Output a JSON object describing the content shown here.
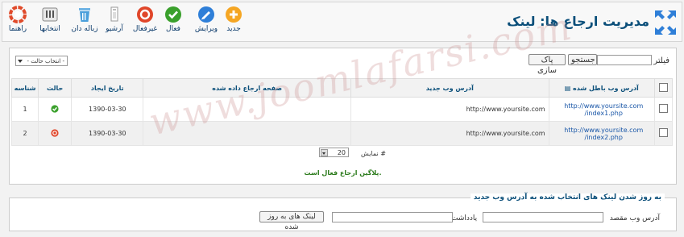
{
  "toolbar": {
    "title": "مدیریت ارجاع ها: لینک",
    "buttons": [
      {
        "label": "جدید",
        "icon": "plus-icon"
      },
      {
        "label": "ویرایش",
        "icon": "edit-icon"
      },
      {
        "label": "فعال",
        "icon": "check-icon"
      },
      {
        "label": "غیرفعال",
        "icon": "unpublish-icon"
      },
      {
        "label": "آرشیو",
        "icon": "archive-icon"
      },
      {
        "label": "زباله دان",
        "icon": "trash-icon"
      },
      {
        "label": "انتخابها",
        "icon": "options-icon"
      },
      {
        "label": "راهنما",
        "icon": "help-icon"
      }
    ]
  },
  "filter": {
    "label": "فیلتر",
    "value": "",
    "search_button": "جستجو",
    "reset_button": "پاک سازی",
    "state_select": "- انتخاب حالت -"
  },
  "table": {
    "headers": {
      "old_url": "آدرس وب باطل شده",
      "new_url": "آدرس وب جدید",
      "referrer": "صفحه ارجاع داده شده",
      "created": "تاریخ ایجاد",
      "state": "حالت",
      "id": "شناسه"
    },
    "rows": [
      {
        "old_url_1": "http://www.yoursite.com",
        "old_url_2": "/index1.php",
        "new_url": "http://www.yoursite.com",
        "referrer": "",
        "created": "1390-03-30",
        "state": "published",
        "id": "1"
      },
      {
        "old_url_1": "http://www.yoursite.com",
        "old_url_2": "/index2.php",
        "new_url": "http://www.yoursite.com",
        "referrer": "",
        "created": "1390-03-30",
        "state": "unpublished",
        "id": "2"
      }
    ]
  },
  "pager": {
    "label": "نمایش #",
    "value": "20"
  },
  "message": "پلاگین ارجاع فعال است.",
  "batch": {
    "legend": "به روز شدن لینک های انتخاب شده به آدرس وب جدید",
    "dest_label": "آدرس وب مقصد",
    "note_label": "یادداشت",
    "dest_value": "",
    "note_value": "",
    "submit_button": "لینک های به روز شده"
  },
  "watermark": "www.joomlafarsi.com",
  "colors": {
    "accent": "#0b4f7a",
    "link": "#1a57a8",
    "success": "#2a7a1a",
    "new_button": "#f5a623",
    "publish": "#3aa02c",
    "unpublish": "#e0462a"
  }
}
